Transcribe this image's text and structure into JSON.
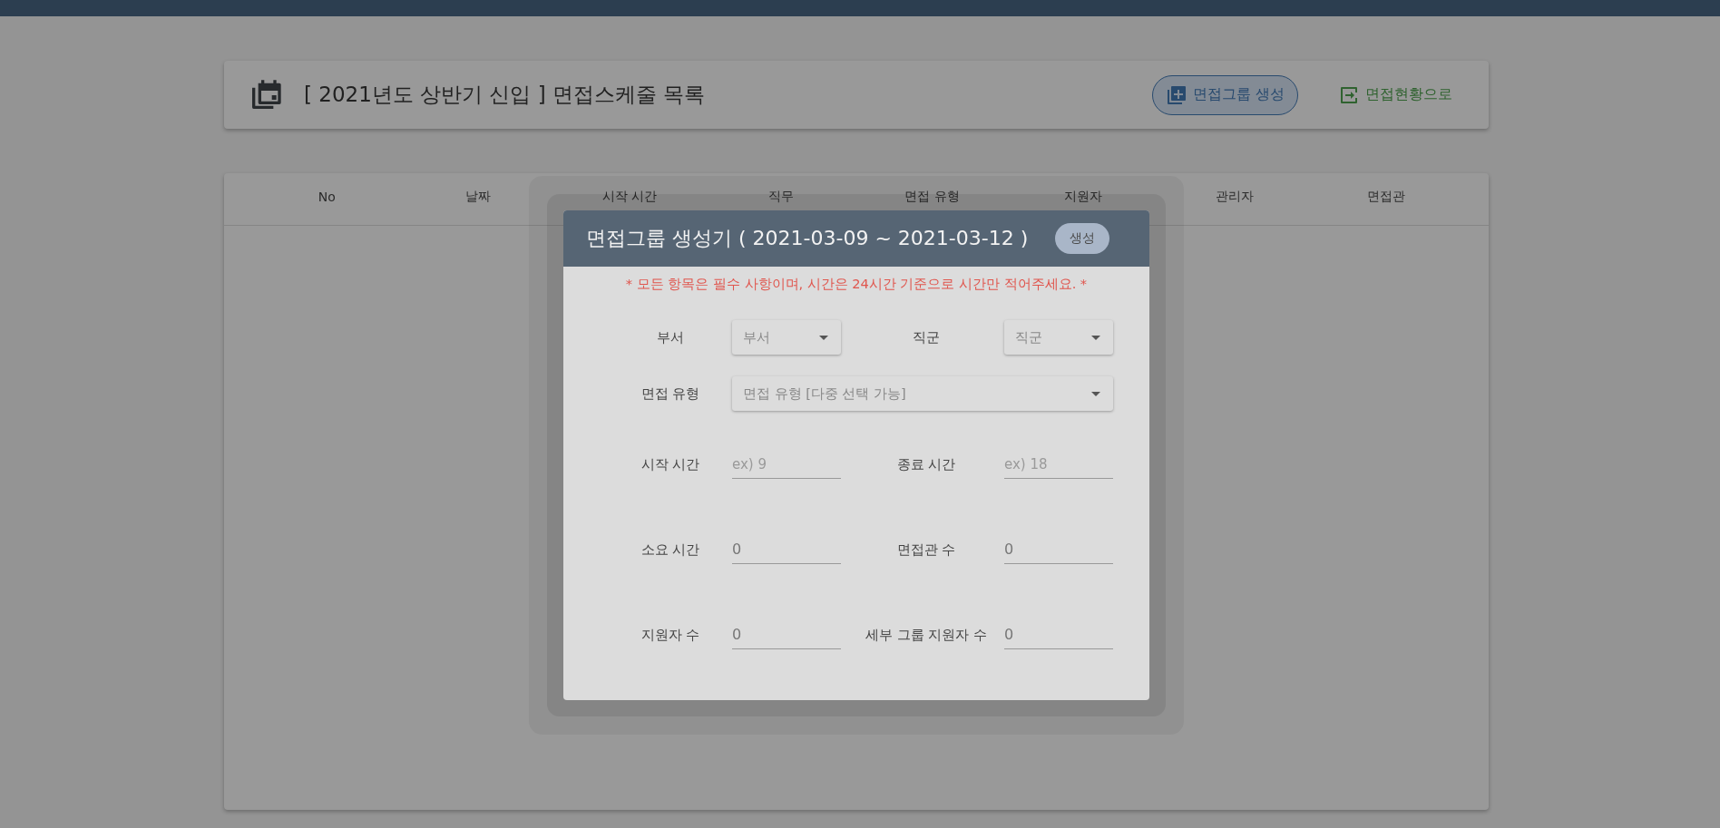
{
  "header": {
    "title": "[ 2021년도 상반기 신입 ] 면접스케줄 목록",
    "buttons": [
      {
        "label": "면접그룹 생성",
        "kind": "create"
      },
      {
        "label": "면접현황으로",
        "kind": "goto"
      }
    ]
  },
  "table": {
    "columns": [
      "No",
      "날짜",
      "시작 시간",
      "직무",
      "면접 유형",
      "지원자",
      "관리자",
      "면접관"
    ]
  },
  "dialog": {
    "title": "면접그룹 생성기 ( 2021-03-09 ~ 2021-03-12 )",
    "action_button": "생성",
    "notice": "* 모든 항목은 필수 사항이며, 시간은 24시간 기준으로 시간만 적어주세요. *",
    "rows": [
      [
        {
          "label": "부서",
          "kind": "select",
          "placeholder": "부서"
        },
        {
          "label": "직군",
          "kind": "select",
          "placeholder": "직군"
        }
      ],
      [
        {
          "label": "면접 유형",
          "kind": "select",
          "placeholder": "면접 유형 [다중 선택 가능]"
        }
      ],
      [
        {
          "label": "시작 시간",
          "kind": "input",
          "placeholder": "ex) 9"
        },
        {
          "label": "종료 시간",
          "kind": "input",
          "placeholder": "ex) 18"
        }
      ],
      [
        {
          "label": "소요 시간",
          "kind": "input",
          "value": "0"
        },
        {
          "label": "면접관 수",
          "kind": "input",
          "value": "0"
        }
      ],
      [
        {
          "label": "지원자 수",
          "kind": "input",
          "value": "0"
        },
        {
          "label": "세부 그룹 지원자 수",
          "kind": "input",
          "value": "0"
        }
      ]
    ]
  }
}
